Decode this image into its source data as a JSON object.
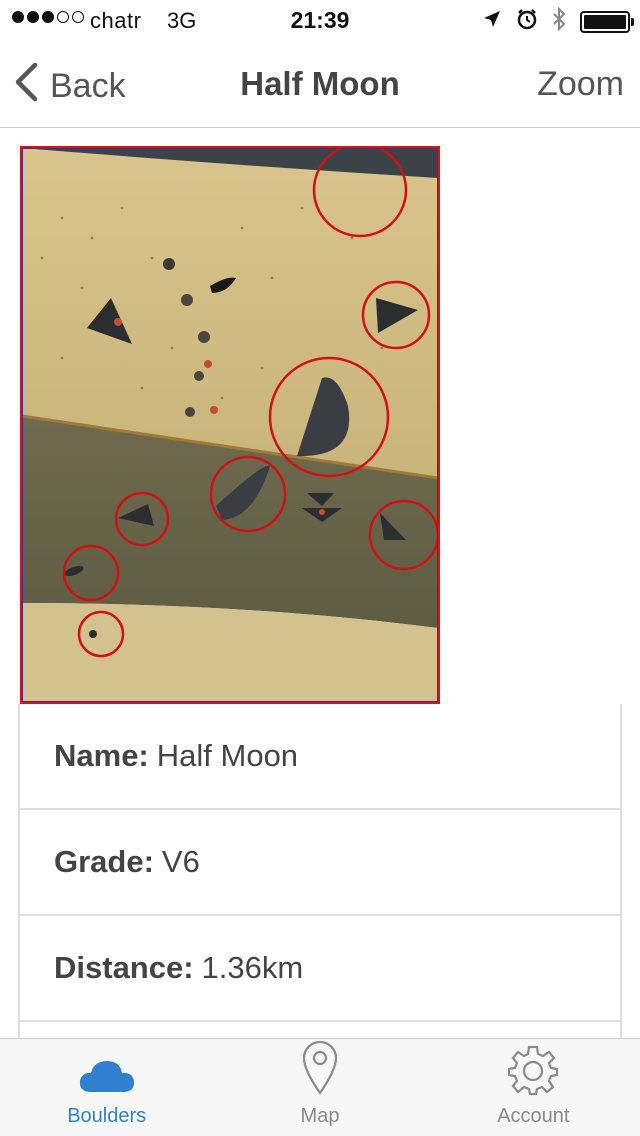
{
  "status_bar": {
    "carrier": "chatr",
    "network": "3G",
    "time": "21:39",
    "signal_bars_filled": 3,
    "signal_bars_total": 5,
    "battery_level": 1.0
  },
  "nav": {
    "back_label": "Back",
    "title": "Half Moon",
    "zoom_label": "Zoom"
  },
  "route_image": {
    "icons": [
      "route-photo"
    ]
  },
  "details": {
    "name_label": "Name:",
    "name_value": "Half Moon",
    "grade_label": "Grade:",
    "grade_value": "V6",
    "distance_label": "Distance:",
    "distance_value": "1.36km"
  },
  "tabs": [
    {
      "label": "Boulders",
      "icon": "cloud-icon",
      "active": true
    },
    {
      "label": "Map",
      "icon": "map-pin-icon",
      "active": false
    },
    {
      "label": "Account",
      "icon": "gear-icon",
      "active": false
    }
  ],
  "colors": {
    "accent": "#2f80d1",
    "highlight_circle": "#d11111",
    "tab_inactive": "#8a8a8a"
  }
}
